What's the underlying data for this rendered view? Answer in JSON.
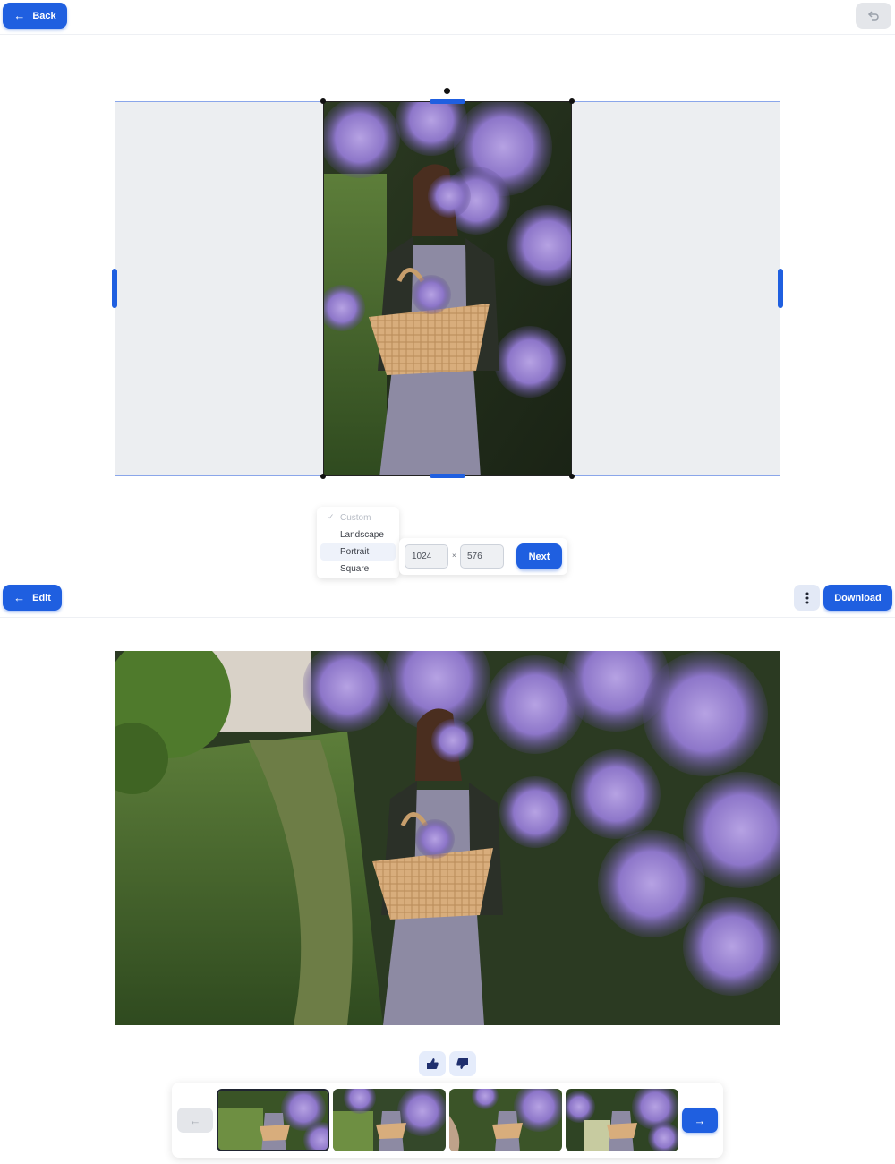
{
  "editor": {
    "back_label": "Back",
    "back_icon": "arrow-left-icon",
    "undo_icon": "undo-icon",
    "aspect_options": [
      "Custom",
      "Landscape",
      "Portrait",
      "Square"
    ],
    "aspect_selected": "Custom",
    "aspect_hovered": "Portrait",
    "width_value": "1024",
    "times_symbol": "×",
    "height_value": "576",
    "next_label": "Next"
  },
  "result": {
    "edit_label": "Edit",
    "edit_icon": "arrow-left-icon",
    "more_icon": "more-vertical-icon",
    "download_label": "Download",
    "like_icon": "thumbs-up-icon",
    "dislike_icon": "thumbs-down-icon",
    "prev_icon": "arrow-left-icon",
    "next_icon": "arrow-right-icon",
    "thumbnail_count": 4,
    "selected_thumbnail": 1
  },
  "colors": {
    "accent": "#1f5fe0",
    "frame_bg": "#eceef1",
    "vote_bg": "#e5ecfb"
  }
}
